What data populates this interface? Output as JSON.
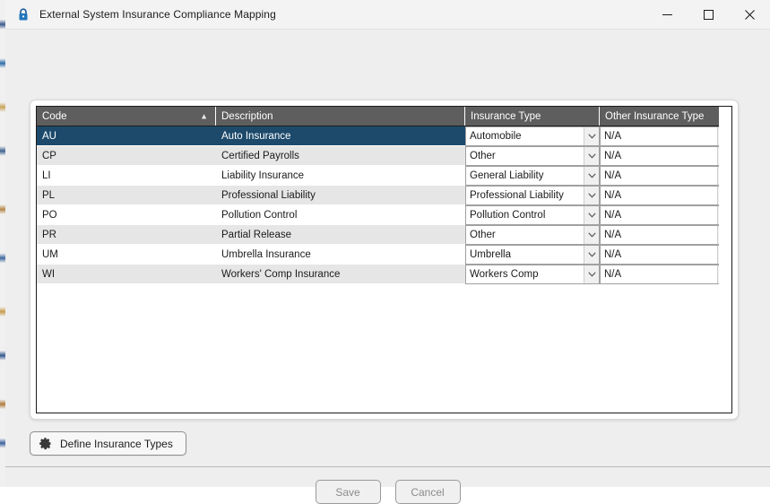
{
  "window": {
    "title": "External System Insurance Compliance Mapping",
    "icon": "lock-icon",
    "controls": {
      "minimize": "—",
      "maximize": "□",
      "close": "✕"
    },
    "accent_selected": "#1d4a6b",
    "header_bg": "#5e5e5e"
  },
  "grid": {
    "columns": [
      {
        "key": "code",
        "label": "Code",
        "sort": "▲"
      },
      {
        "key": "desc",
        "label": "Description",
        "sort": ""
      },
      {
        "key": "ins",
        "label": "Insurance Type",
        "sort": ""
      },
      {
        "key": "other",
        "label": "Other Insurance Type",
        "sort": ""
      }
    ],
    "rows": [
      {
        "code": "AU",
        "desc": "Auto Insurance",
        "ins": "Automobile",
        "other": "N/A",
        "selected": true
      },
      {
        "code": "CP",
        "desc": "Certified Payrolls",
        "ins": "Other",
        "other": "N/A",
        "selected": false
      },
      {
        "code": "LI",
        "desc": "Liability Insurance",
        "ins": "General Liability",
        "other": "N/A",
        "selected": false
      },
      {
        "code": "PL",
        "desc": "Professional Liability",
        "ins": "Professional Liability",
        "other": "N/A",
        "selected": false
      },
      {
        "code": "PO",
        "desc": "Pollution Control",
        "ins": "Pollution Control",
        "other": "N/A",
        "selected": false
      },
      {
        "code": "PR",
        "desc": "Partial Release",
        "ins": "Other",
        "other": "N/A",
        "selected": false
      },
      {
        "code": "UM",
        "desc": "Umbrella Insurance",
        "ins": "Umbrella",
        "other": "N/A",
        "selected": false
      },
      {
        "code": "WI",
        "desc": "Workers' Comp Insurance",
        "ins": "Workers Comp",
        "other": "N/A",
        "selected": false
      }
    ]
  },
  "actions": {
    "define_label": "Define Insurance Types",
    "define_icon": "gear-icon",
    "save_label": "Save",
    "cancel_label": "Cancel"
  }
}
